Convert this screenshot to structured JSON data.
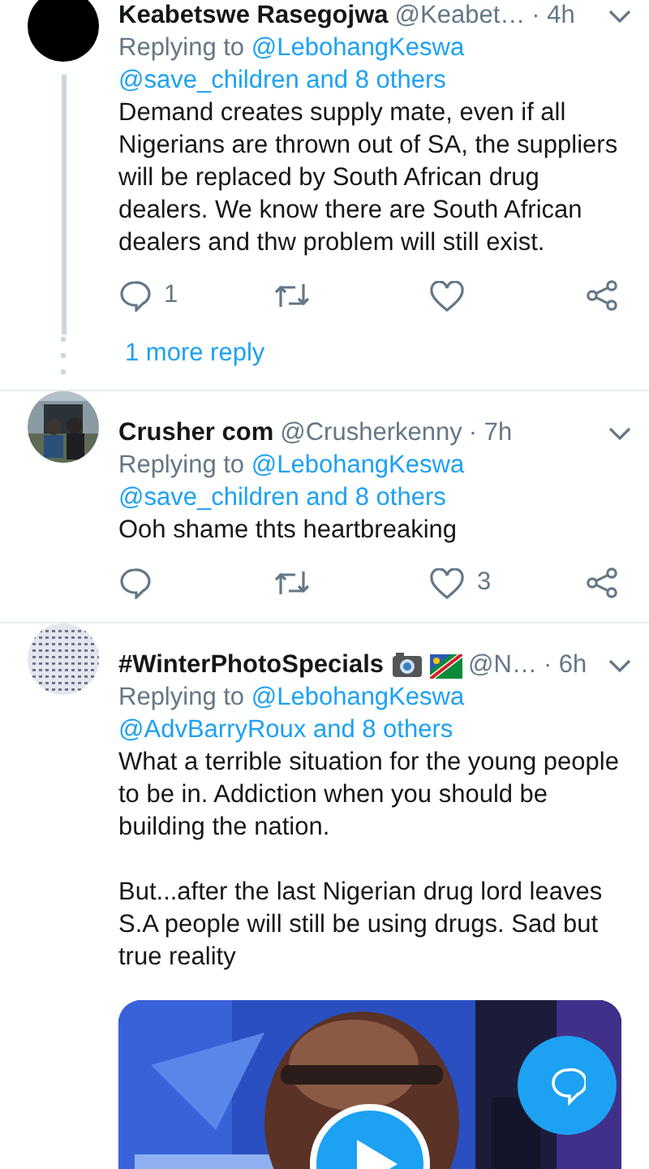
{
  "tweets": [
    {
      "name": "Keabetswe Rasegojwa",
      "handle": "@Keabet…",
      "time": "· 4h",
      "avatar": {
        "kind": "solid"
      },
      "reply_label": "Replying to",
      "mention": "@LebohangKeswa",
      "others": "@save_children and 8 others",
      "paragraphs": [
        "Demand creates supply mate, even if all Nigerians are thrown out of SA, the suppliers will be replaced by South African drug dealers. We know there are South African dealers and thw problem will still exist."
      ],
      "reply_count": "1",
      "thread": true,
      "more_replies": "1 more reply"
    },
    {
      "name": "Crusher com",
      "handle": "@Crusherkenny",
      "time": "· 7h",
      "avatar": {
        "kind": "picture"
      },
      "reply_label": "Replying to",
      "mention": "@LebohangKeswa",
      "others": "@save_children and 8 others",
      "paragraphs": [
        "Ooh shame thts heartbreaking"
      ],
      "like_count": "3",
      "thread": false
    },
    {
      "name": "#WinterPhotoSpecials",
      "name_icons": true,
      "handle": "@N…",
      "time": "· 6h",
      "avatar": {
        "kind": "pattern"
      },
      "reply_label": "Replying to",
      "mention": "@LebohangKeswa",
      "others": "@AdvBarryRoux and 8 others",
      "paragraphs": [
        "What a terrible situation for the young people to be in. Addiction when you should be building the nation.",
        "But...after the last Nigerian drug lord leaves S.A people will still be using drugs. Sad but true reality"
      ],
      "media": {
        "kind": "video"
      },
      "thread": false
    }
  ]
}
